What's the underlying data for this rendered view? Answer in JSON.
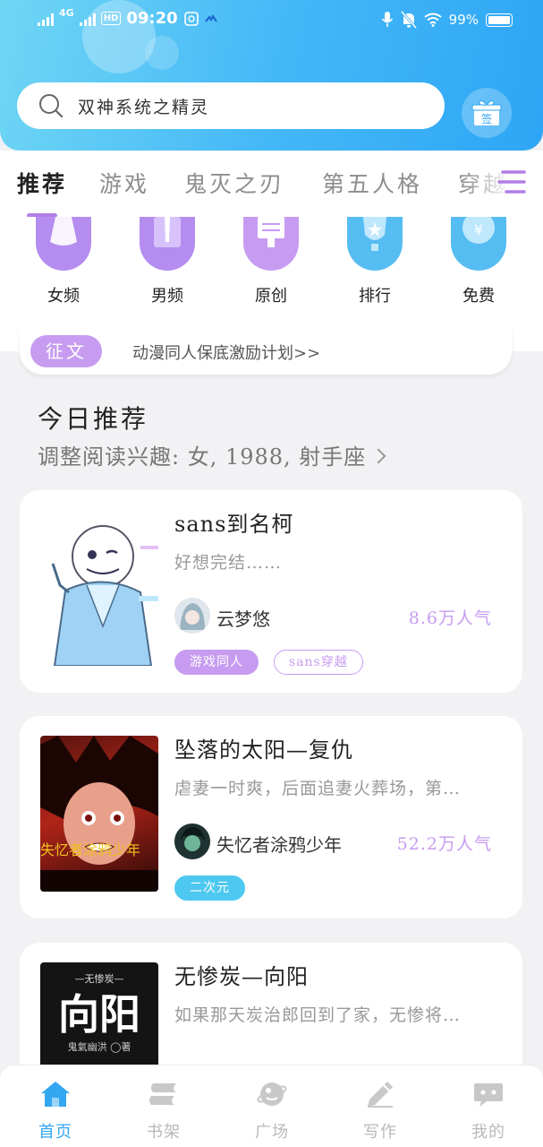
{
  "status_bar": {
    "network": "4G",
    "hd": "HD",
    "time": "09:20",
    "battery": "99%"
  },
  "search": {
    "text": "双神系统之精灵"
  },
  "gift_button": {
    "label": "签"
  },
  "tabs": [
    {
      "label": "推荐",
      "active": true
    },
    {
      "label": "游戏"
    },
    {
      "label": "鬼灭之刃"
    },
    {
      "label": "第五人格"
    },
    {
      "label": "穿越"
    }
  ],
  "categories": [
    {
      "label": "女频",
      "color": "#b58cf0"
    },
    {
      "label": "男频",
      "color": "#b58cf0"
    },
    {
      "label": "原创",
      "color": "#c79cf0"
    },
    {
      "label": "排行",
      "color": "#56bdf2"
    },
    {
      "label": "免费",
      "color": "#56bdf2"
    }
  ],
  "banner": {
    "tag": "征文",
    "text": "动漫同人保底激励计划>>"
  },
  "section": {
    "title": "今日推荐",
    "subtitle": "调整阅读兴趣: 女, 1988, 射手座"
  },
  "books": [
    {
      "title": "sans到名柯",
      "desc": "好想完结……",
      "author": "云梦悠",
      "popularity": "8.6万人气",
      "tags": [
        "游戏同人",
        "sans穿越"
      ]
    },
    {
      "title": "坠落的太阳—复仇",
      "desc": "虐妻一时爽，后面追妻火葬场，第…",
      "author": "失忆者涂鸦少年",
      "popularity": "52.2万人气",
      "cover_text": "失忆者涂鸦少年",
      "tags": [
        "二次元"
      ]
    },
    {
      "title": "无惨炭—向阳",
      "desc": "如果那天炭治郎回到了家，无惨将…",
      "cover_top": "—无惨炭—",
      "cover_big": "向阳",
      "cover_author": "鬼氣幽洪 ◯著"
    }
  ],
  "bottom_nav": [
    {
      "label": "首页",
      "active": true
    },
    {
      "label": "书架"
    },
    {
      "label": "广场"
    },
    {
      "label": "写作"
    },
    {
      "label": "我的"
    }
  ],
  "colors": {
    "accent_blue": "#34a6f2",
    "accent_purple": "#c79cf0",
    "header_gradient_start": "#6fd6f4",
    "header_gradient_end": "#2ea6f5"
  }
}
